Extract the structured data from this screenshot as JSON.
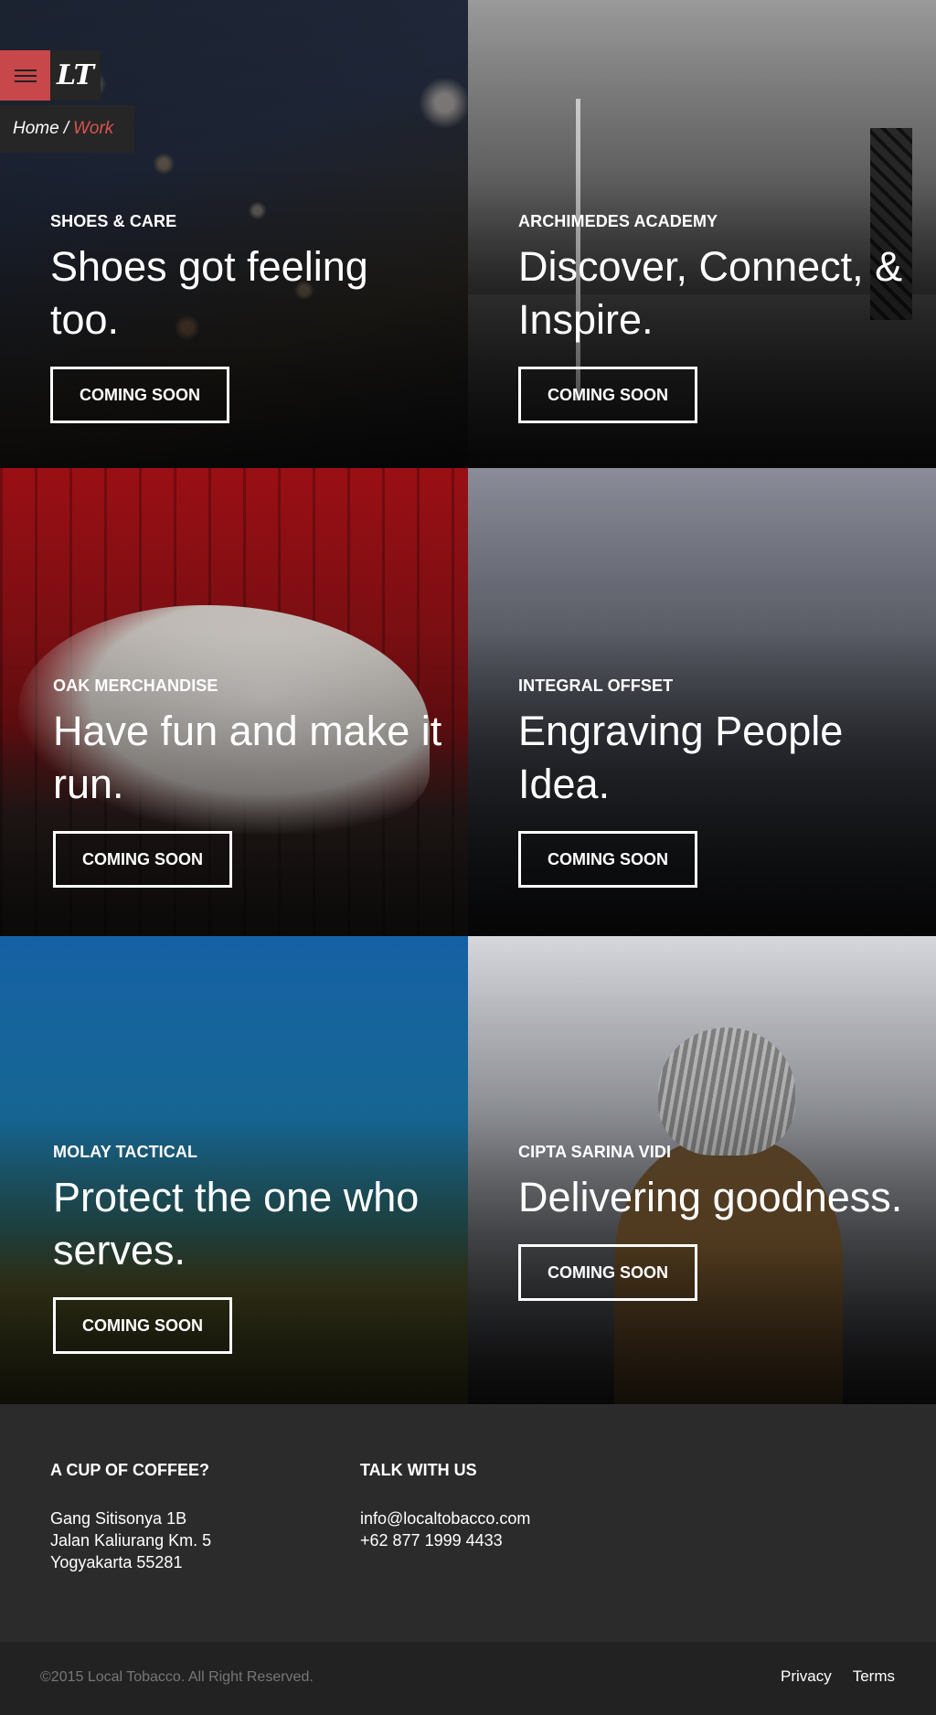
{
  "header": {
    "logo_text": "LT",
    "breadcrumb": {
      "home": "Home",
      "separator": "/",
      "current": "Work"
    },
    "accent_color": "#c8474b"
  },
  "projects": [
    {
      "client": "SHOES & CARE",
      "headline": "Shoes got feeling too.",
      "cta": "COMING SOON"
    },
    {
      "client": "ARCHIMEDES ACADEMY",
      "headline": "Discover, Connect, & Inspire.",
      "cta": "COMING SOON"
    },
    {
      "client": "OAK MERCHANDISE",
      "headline": "Have fun and make it run.",
      "cta": "COMING SOON"
    },
    {
      "client": "INTEGRAL OFFSET",
      "headline": "Engraving People Idea.",
      "cta": "COMING SOON"
    },
    {
      "client": "MOLAY TACTICAL",
      "headline": "Protect the one who serves.",
      "cta": "COMING SOON"
    },
    {
      "client": "CIPTA SARINA VIDI",
      "headline": "Delivering goodness.",
      "cta": "COMING SOON"
    }
  ],
  "footer": {
    "address_title": "A CUP OF COFFEE?",
    "address_lines": [
      "Gang Sitisonya 1B",
      "Jalan Kaliurang Km. 5",
      "Yogyakarta 55281"
    ],
    "contact_title": "TALK WITH US",
    "email": "info@localtobacco.com",
    "phone": "+62 877 1999 4433",
    "copyright": "©2015 Local Tobacco. All Right Reserved.",
    "links": [
      "Privacy",
      "Terms"
    ]
  }
}
